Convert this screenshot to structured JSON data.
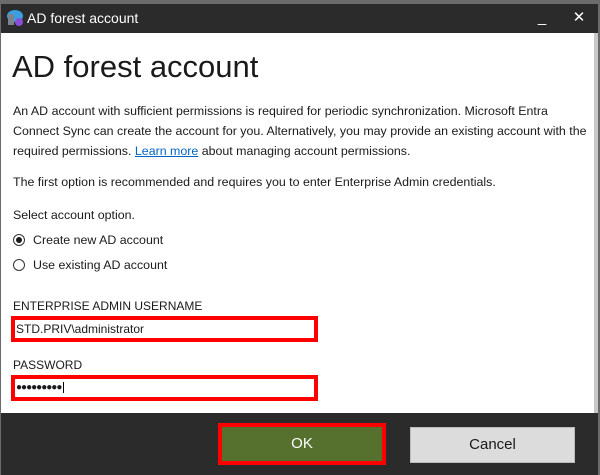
{
  "window": {
    "title": "AD forest account",
    "minimize": "_",
    "close": "✕"
  },
  "page": {
    "heading": "AD forest account",
    "intro_1": "An AD account with sufficient permissions is required for periodic synchronization. Microsoft Entra Connect Sync can create the account for you. Alternatively, you may provide an existing account with the required permissions. ",
    "learn_more": "Learn more",
    "intro_2": " about managing account permissions.",
    "recommend": "The first option is recommended and requires you to enter Enterprise Admin credentials.",
    "select_label": "Select account option.",
    "options": [
      {
        "label": "Create new AD account",
        "selected": true
      },
      {
        "label": "Use existing AD account",
        "selected": false
      }
    ],
    "username_label": "ENTERPRISE ADMIN USERNAME",
    "username_value": "STD.PRIV\\administrator",
    "password_label": "PASSWORD",
    "password_value": "●●●●●●●●●"
  },
  "footer": {
    "ok": "OK",
    "cancel": "Cancel"
  },
  "colors": {
    "ok_bg": "#56702e",
    "highlight": "#ff0000",
    "titlebar": "#2b2b2b"
  }
}
